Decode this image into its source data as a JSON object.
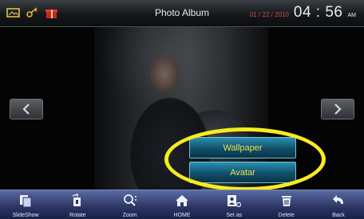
{
  "window": {
    "title": "Photo Album"
  },
  "status": {
    "date": "01 / 22 / 2010",
    "time": "04 : 56",
    "ampm": "AM",
    "icons": [
      "photo-icon",
      "key-icon",
      "gift-icon"
    ]
  },
  "popup_menu": {
    "items": [
      {
        "label": "Wallpaper"
      },
      {
        "label": "Avatar"
      }
    ],
    "highlight_color": "#f6ec1e"
  },
  "toolbar": {
    "items": [
      {
        "label": "SlideShow",
        "icon": "slideshow-icon"
      },
      {
        "label": "Rotate",
        "icon": "rotate-icon"
      },
      {
        "label": "Zoom",
        "icon": "zoom-icon"
      },
      {
        "label": "HOME",
        "icon": "home-icon"
      },
      {
        "label": "Set as",
        "icon": "set-as-icon"
      },
      {
        "label": "Delete",
        "icon": "trash-icon"
      },
      {
        "label": "Back",
        "icon": "back-arrow-icon"
      }
    ]
  },
  "colors": {
    "menu_text": "#f2e14a",
    "date_text": "#d74a4a",
    "toolbar_bg": "#2b3562"
  }
}
